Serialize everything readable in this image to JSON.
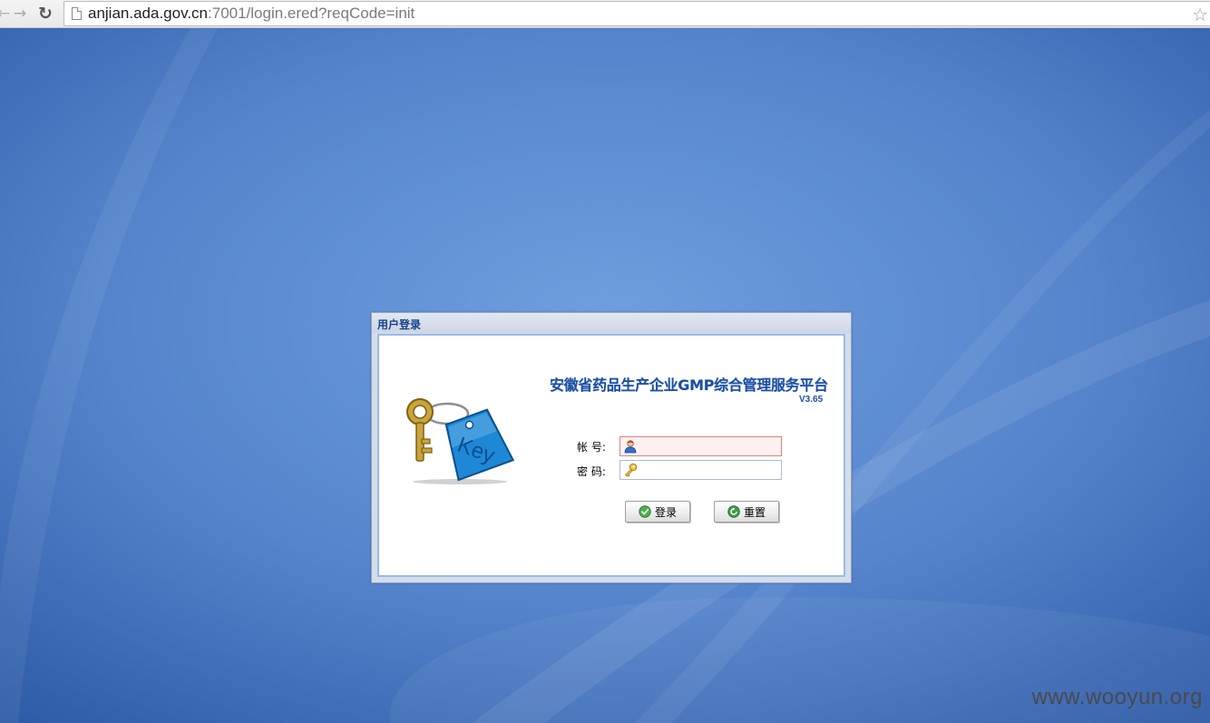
{
  "browser": {
    "url_host": "anjian.ada.gov.cn",
    "url_rest": ":7001/login.ered?reqCode=init"
  },
  "login": {
    "window_title": "用户登录",
    "system_title": "安徽省药品生产企业GMP综合管理服务平台",
    "version": "V3.65",
    "account_label": "帐 号:",
    "password_label": "密 码:",
    "account_value": "",
    "password_value": "",
    "login_button": "登录",
    "reset_button": "重置",
    "key_tag_text": "Key"
  },
  "watermark": "www.wooyun.org",
  "colors": {
    "background": "#3a6cb8",
    "title_text": "#1e4fa3",
    "window_title_text": "#15428b",
    "account_field_border": "#e08282"
  }
}
